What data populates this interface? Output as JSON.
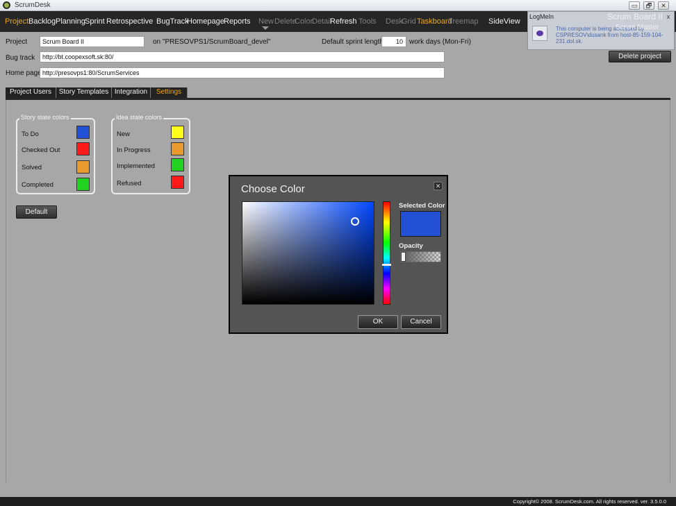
{
  "window": {
    "title": "ScrumDesk",
    "minimize": "▭",
    "restore": "🗗",
    "close": "✕"
  },
  "menu": {
    "items": [
      {
        "label": "Project",
        "state": "active"
      },
      {
        "label": "Backlog",
        "state": "normal"
      },
      {
        "label": "Planning",
        "state": "normal"
      },
      {
        "label": "Sprint",
        "state": "normal"
      },
      {
        "label": "Retrospective",
        "state": "normal"
      },
      {
        "label": "BugTrack",
        "state": "normal"
      },
      {
        "label": "Homepage",
        "state": "normal"
      },
      {
        "label": "Reports",
        "state": "normal"
      },
      {
        "label": "New",
        "state": "dim"
      },
      {
        "label": "Delete",
        "state": "dim"
      },
      {
        "label": "Color",
        "state": "dim"
      },
      {
        "label": "Detail",
        "state": "dim"
      },
      {
        "label": "Refresh",
        "state": "normal"
      },
      {
        "label": "Tools",
        "state": "dim"
      },
      {
        "label": "Desk",
        "state": "dim"
      },
      {
        "label": "Grid",
        "state": "dim"
      },
      {
        "label": "Taskboard",
        "state": "active"
      },
      {
        "label": "Treemap",
        "state": "dim"
      },
      {
        "label": "SideView",
        "state": "normal"
      }
    ]
  },
  "header": {
    "board_title": "Scrum Board II",
    "role": "Scrum Master"
  },
  "logmein": {
    "title": "LogMeIn",
    "close": "x",
    "message": "This computer is being accessed by CSPRESOV\\dusank from host-85-159-104-231.dol.sk."
  },
  "project": {
    "project_label": "Project",
    "project_value": "Scrum Board II",
    "server_text": "on \"PRESOVPS1/ScrumBoard_devel\"",
    "sprint_label": "Default sprint length",
    "sprint_value": "10",
    "sprint_unit": "work days (Mon-Fri)",
    "bugtrack_label": "Bug track",
    "bugtrack_value": "http://bt.coopexsoft.sk:80/",
    "homepage_label": "Home page",
    "homepage_value": "http://presovps1:80/ScrumServices",
    "delete_button": "Delete project"
  },
  "tabs": [
    {
      "label": "Project Users",
      "active": false
    },
    {
      "label": "Story Templates",
      "active": false
    },
    {
      "label": "Integration",
      "active": false
    },
    {
      "label": "Settings",
      "active": true
    }
  ],
  "story_states": {
    "title": "Story state colors",
    "items": [
      {
        "label": "To Do",
        "color": "#2251d6"
      },
      {
        "label": "Checked Out",
        "color": "#ff1a1a"
      },
      {
        "label": "Solved",
        "color": "#e89a2e"
      },
      {
        "label": "Completed",
        "color": "#1fd31f"
      }
    ]
  },
  "idea_states": {
    "title": "Idea state colors",
    "items": [
      {
        "label": "New",
        "color": "#ffff1a"
      },
      {
        "label": "In Progress",
        "color": "#e89a2e"
      },
      {
        "label": "Implemented",
        "color": "#1fd31f"
      },
      {
        "label": "Refused",
        "color": "#ff1a1a"
      }
    ]
  },
  "default_button": "Default",
  "color_dialog": {
    "title": "Choose Color",
    "close": "✕",
    "selected_label": "Selected Color",
    "selected_color": "#2251d6",
    "opacity_label": "Opacity",
    "opacity": 0,
    "ok": "OK",
    "cancel": "Cancel"
  },
  "status": {
    "copyright": "Copyright© 2008. ScrumDesk.com. All rights reserved. ver. 3.5.0.0"
  }
}
